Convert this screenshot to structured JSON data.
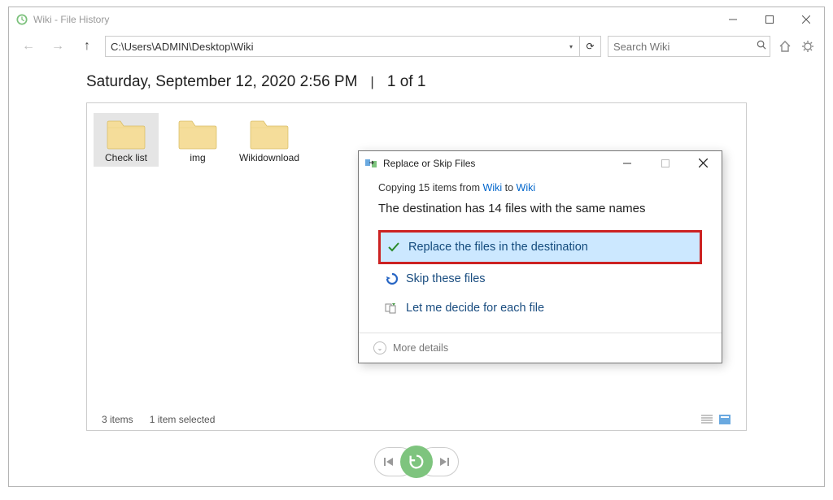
{
  "window": {
    "title": "Wiki - File History",
    "minimize": "—",
    "maximize": "□",
    "close": "✕"
  },
  "nav": {
    "back": "←",
    "forward": "→",
    "up": "↑"
  },
  "address": {
    "path": "C:\\Users\\ADMIN\\Desktop\\Wiki",
    "dropdown": "▾",
    "refresh": "⟳"
  },
  "search": {
    "placeholder": "Search Wiki",
    "icon": "🔍"
  },
  "toolbar": {
    "home": "⌂",
    "settings": "⚙"
  },
  "file_history": {
    "timestamp": "Saturday, September 12, 2020 2:56 PM",
    "separator": "|",
    "page": "1 of 1"
  },
  "folders": [
    {
      "name": "Check list",
      "selected": true
    },
    {
      "name": "img",
      "selected": false
    },
    {
      "name": "Wikidownload",
      "selected": false
    }
  ],
  "status": {
    "count": "3 items",
    "selected": "1 item selected"
  },
  "bottom_nav": {
    "prev": "|◀",
    "next": "▶|"
  },
  "dialog": {
    "title": "Replace or Skip Files",
    "minimize": "—",
    "maximize": "□",
    "close": "✕",
    "copy_prefix": "Copying 15 items from ",
    "copy_src": "Wiki",
    "copy_to": " to ",
    "copy_dst": "Wiki",
    "destination_line": "The destination has 14 files with the same names",
    "opt_replace": "Replace the files in the destination",
    "opt_skip": "Skip these files",
    "opt_decide": "Let me decide for each file",
    "more_details": "More details"
  }
}
